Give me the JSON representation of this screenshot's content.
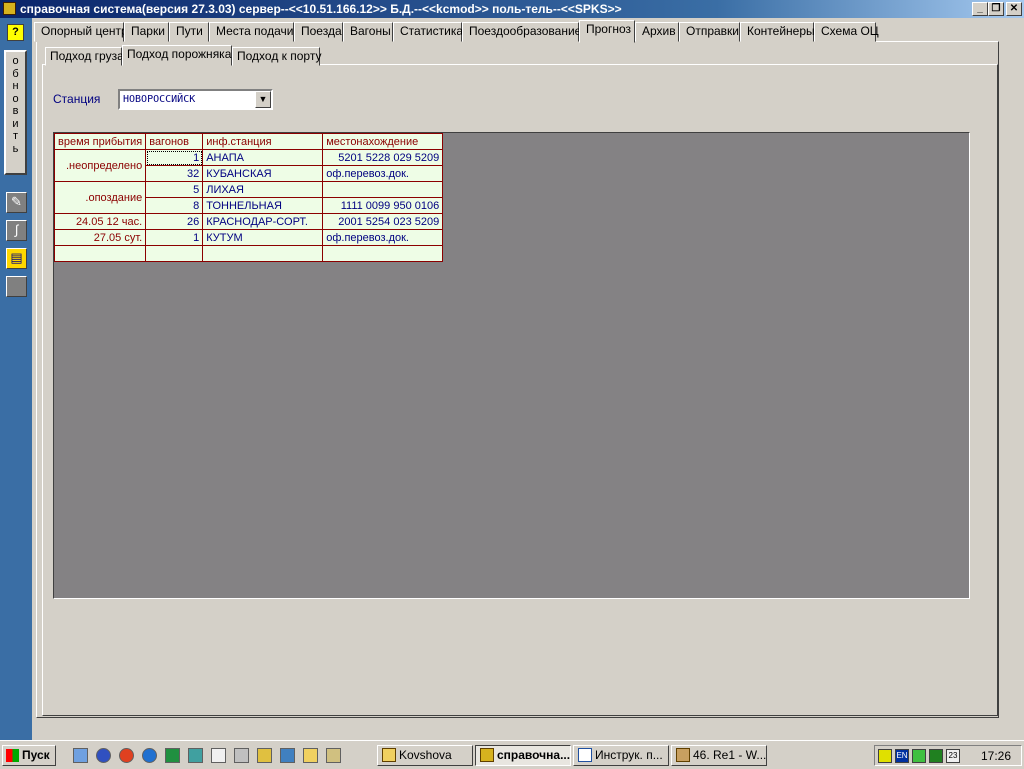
{
  "window": {
    "title": "справочная система(версия 27.3.03) сервер--<<10.51.166.12>> Б.Д.--<<kcmod>> поль-тель--<<SPKS>>"
  },
  "sidebar": {
    "help_label": "?",
    "refresh_letters": [
      "о",
      "б",
      "н",
      "о",
      "в",
      "и",
      "т",
      "ь"
    ]
  },
  "tabs": [
    "Опорный центр",
    "Парки",
    "Пути",
    "Места подачи",
    "Поезда",
    "Вагоны",
    "Статистика",
    "Поездообразование",
    "Прогноз",
    "Архив",
    "Отправки",
    "Контейнеры",
    "Схема ОЦ"
  ],
  "subtabs": [
    "Подход груза",
    "Подход порожняка",
    "Подход к порту"
  ],
  "station": {
    "label": "Станция",
    "value": "НОВОРОССИЙСК"
  },
  "table": {
    "headers": [
      "время прибытия",
      "вагонов",
      "инф.станция",
      "местонахождение"
    ],
    "rows": [
      {
        "time": ".неопределено",
        "wagons": "1",
        "station": "АНАПА",
        "location": "5201 5228 029 5209"
      },
      {
        "time": "",
        "wagons": "32",
        "station": "КУБАНСКАЯ",
        "location": "оф.перевоз.док."
      },
      {
        "time": ".опоздание",
        "wagons": "5",
        "station": "ЛИХАЯ",
        "location": ""
      },
      {
        "time": "",
        "wagons": "8",
        "station": "ТОННЕЛЬНАЯ",
        "location": "1111 0099 950 0106"
      },
      {
        "time": "24.05 12 час.",
        "wagons": "26",
        "station": "КРАСНОДАР-СОРТ.",
        "location": "2001 5254 023 5209"
      },
      {
        "time": "27.05 сут.",
        "wagons": "1",
        "station": "КУТУМ",
        "location": "оф.перевоз.док."
      },
      {
        "time": "",
        "wagons": "",
        "station": "",
        "location": ""
      }
    ]
  },
  "taskbar": {
    "start_label": "Пуск",
    "tasks": [
      "Kovshova",
      "справочна...",
      "Инструк. п...",
      "46. Re1 - W..."
    ],
    "tray_lang": "EN",
    "tray_cal": "23",
    "clock": "17:26"
  }
}
